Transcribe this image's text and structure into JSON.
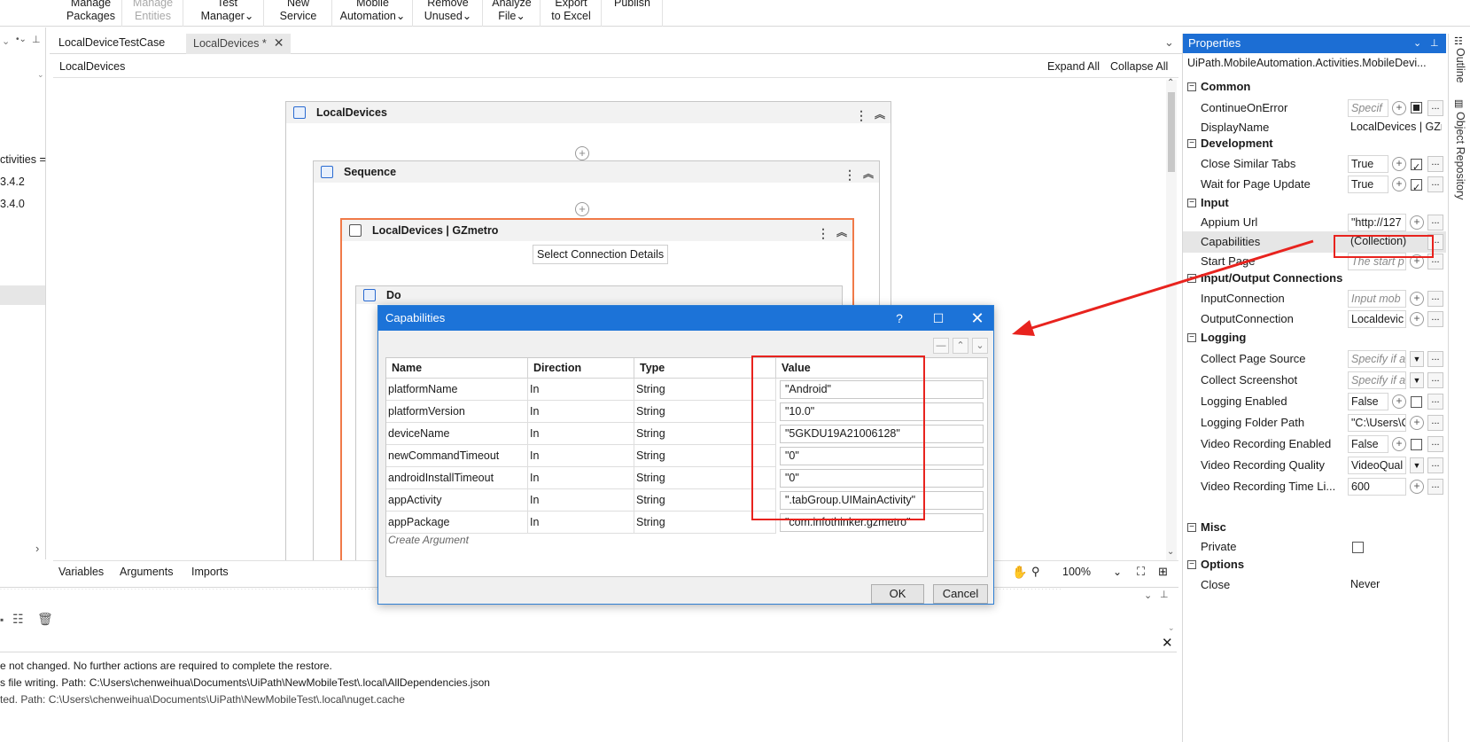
{
  "ribbon": {
    "buttons": [
      {
        "line1": "Manage",
        "line2": "Packages"
      },
      {
        "line1": "Manage",
        "line2": "Entities"
      },
      {
        "line1": "Test",
        "line2": "Manager⌄"
      },
      {
        "line1": "New",
        "line2": "Service"
      },
      {
        "line1": "Mobile",
        "line2": "Automation⌄"
      },
      {
        "line1": "Remove",
        "line2": "Unused⌄"
      },
      {
        "line1": "Analyze",
        "line2": "File⌄"
      },
      {
        "line1": "Export",
        "line2": "to Excel"
      },
      {
        "line1": "Publish",
        "line2": ""
      }
    ]
  },
  "left_panel": {
    "partial_items": [
      "ctivities =",
      "3.4.2",
      "3.4.0"
    ]
  },
  "tabs": [
    {
      "label": "LocalDeviceTestCase"
    },
    {
      "label": "LocalDevices *"
    }
  ],
  "designer": {
    "breadcrumb": "LocalDevices",
    "expand_all": "Expand All",
    "collapse_all": "Collapse All",
    "root_activity": "LocalDevices",
    "sequence_activity": "Sequence",
    "mobile_activity": "LocalDevices | GZmetro",
    "select_connection": "Select Connection Details",
    "inner_partial": "Do"
  },
  "designer_footer": {
    "variables": "Variables",
    "arguments": "Arguments",
    "imports": "Imports",
    "zoom": "100%"
  },
  "output": {
    "lines": [
      "e not changed. No further actions are required to complete the restore.",
      "s file writing. Path: C:\\Users\\chenweihua\\Documents\\UiPath\\NewMobileTest\\.local\\AllDependencies.json",
      "ted. Path: C:\\Users\\chenweihua\\Documents\\UiPath\\NewMobileTest\\.local\\nuget.cache"
    ]
  },
  "properties": {
    "title": "Properties",
    "type_name": "UiPath.MobileAutomation.Activities.MobileDevi...",
    "categories": {
      "common": "Common",
      "development": "Development",
      "input": "Input",
      "io_connections": "Input/Output Connections",
      "logging": "Logging",
      "misc": "Misc",
      "options": "Options"
    },
    "rows": {
      "continue_on_error": {
        "name": "ContinueOnError",
        "value": "Specif"
      },
      "display_name": {
        "name": "DisplayName",
        "value": "LocalDevices | GZm"
      },
      "close_similar_tabs": {
        "name": "Close Similar Tabs",
        "value": "True"
      },
      "wait_for_page_update": {
        "name": "Wait for Page Update",
        "value": "True"
      },
      "appium_url": {
        "name": "Appium Url",
        "value": "\"http://127"
      },
      "capabilities": {
        "name": "Capabilities",
        "value": "(Collection)"
      },
      "start_page": {
        "name": "Start Page",
        "value": "The start p"
      },
      "input_connection": {
        "name": "InputConnection",
        "value": "Input mob"
      },
      "output_connection": {
        "name": "OutputConnection",
        "value": "Localdevic"
      },
      "collect_page_source": {
        "name": "Collect Page Source",
        "value": "Specify if a"
      },
      "collect_screenshot": {
        "name": "Collect Screenshot",
        "value": "Specify if a"
      },
      "logging_enabled": {
        "name": "Logging Enabled",
        "value": "False"
      },
      "logging_folder_path": {
        "name": "Logging Folder Path",
        "value": "\"C:\\Users\\C"
      },
      "video_recording_enabled": {
        "name": "Video Recording Enabled",
        "value": "False"
      },
      "video_recording_quality": {
        "name": "Video Recording Quality",
        "value": "VideoQual"
      },
      "video_recording_time_limit": {
        "name": "Video Recording Time Li...",
        "value": "600"
      },
      "private": {
        "name": "Private",
        "value": ""
      },
      "close": {
        "name": "Close",
        "value": "Never"
      }
    }
  },
  "side_strip": {
    "outline": "Outline",
    "object_repository": "Object Repository"
  },
  "dialog": {
    "title": "Capabilities",
    "help": "?",
    "columns": [
      "Name",
      "Direction",
      "Type",
      "Value"
    ],
    "rows": [
      {
        "name": "platformName",
        "direction": "In",
        "type": "String",
        "value": "\"Android\""
      },
      {
        "name": "platformVersion",
        "direction": "In",
        "type": "String",
        "value": "\"10.0\""
      },
      {
        "name": "deviceName",
        "direction": "In",
        "type": "String",
        "value": "\"5GKDU19A21006128\""
      },
      {
        "name": "newCommandTimeout",
        "direction": "In",
        "type": "String",
        "value": "\"0\""
      },
      {
        "name": "androidInstallTimeout",
        "direction": "In",
        "type": "String",
        "value": "\"0\""
      },
      {
        "name": "appActivity",
        "direction": "In",
        "type": "String",
        "value": "\".tabGroup.UIMainActivity\""
      },
      {
        "name": "appPackage",
        "direction": "In",
        "type": "String",
        "value": "\"com.infothinker.gzmetro\""
      }
    ],
    "create_argument": "Create Argument",
    "ok": "OK",
    "cancel": "Cancel"
  },
  "colors": {
    "accent": "#1c73d8",
    "annotation": "#e8231e",
    "selected_activity": "#f07a48"
  }
}
